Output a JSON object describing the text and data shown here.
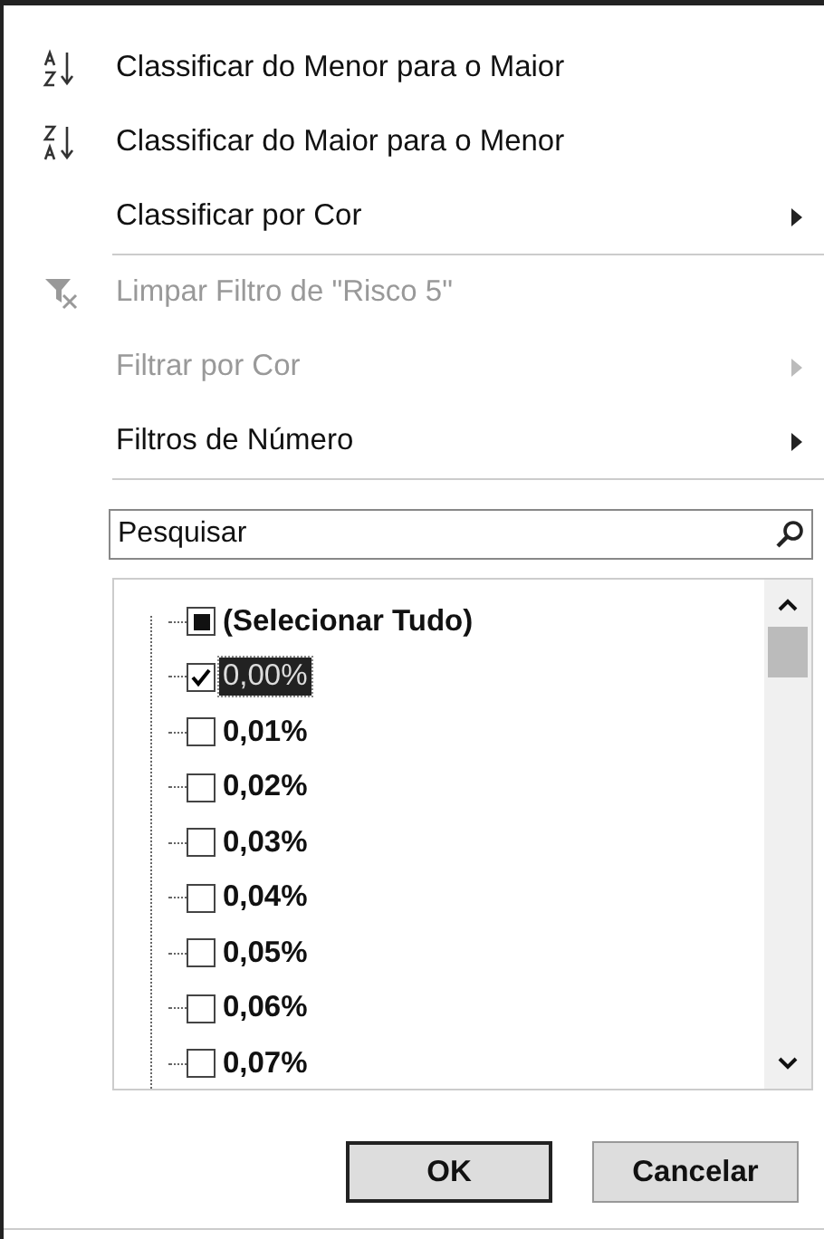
{
  "menu": [
    {
      "kind": "sort-asc",
      "label": "Classificar do Menor para o Maior",
      "disabled": false,
      "submenu": false
    },
    {
      "kind": "sort-desc",
      "label": "Classificar do Maior para o Menor",
      "disabled": false,
      "submenu": false
    },
    {
      "kind": "plain",
      "label": "Classificar por Cor",
      "disabled": false,
      "submenu": true
    },
    {
      "kind": "separator"
    },
    {
      "kind": "clear-filter",
      "label": "Limpar Filtro de \"Risco 5\"",
      "disabled": true,
      "submenu": false
    },
    {
      "kind": "plain",
      "label": "Filtrar por Cor",
      "disabled": true,
      "submenu": true
    },
    {
      "kind": "plain",
      "label": "Filtros de Número",
      "disabled": false,
      "submenu": true
    },
    {
      "kind": "separator"
    }
  ],
  "search": {
    "placeholder": "Pesquisar"
  },
  "values": [
    {
      "label": "(Selecionar Tudo)",
      "checked": false,
      "partial": true,
      "selected": false
    },
    {
      "label": "0,00%",
      "checked": true,
      "partial": false,
      "selected": true
    },
    {
      "label": "0,01%",
      "checked": false,
      "partial": false,
      "selected": false
    },
    {
      "label": "0,02%",
      "checked": false,
      "partial": false,
      "selected": false
    },
    {
      "label": "0,03%",
      "checked": false,
      "partial": false,
      "selected": false
    },
    {
      "label": "0,04%",
      "checked": false,
      "partial": false,
      "selected": false
    },
    {
      "label": "0,05%",
      "checked": false,
      "partial": false,
      "selected": false
    },
    {
      "label": "0,06%",
      "checked": false,
      "partial": false,
      "selected": false
    },
    {
      "label": "0,07%",
      "checked": false,
      "partial": false,
      "selected": false
    }
  ],
  "buttons": [
    {
      "label": "OK",
      "default": true
    },
    {
      "label": "Cancelar",
      "default": false
    }
  ]
}
